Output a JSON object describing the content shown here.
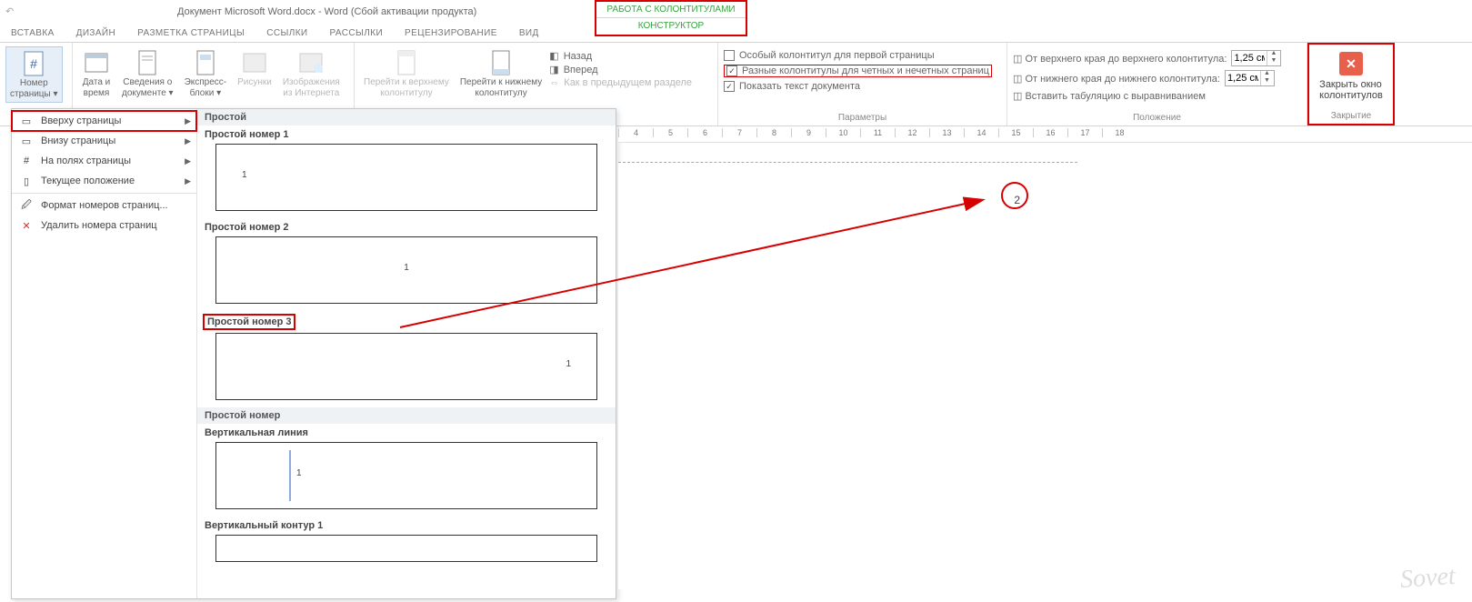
{
  "title": "Документ Microsoft Word.docx - Word (Сбой активации продукта)",
  "contextual_tab": {
    "title": "РАБОТА С КОЛОНТИТУЛАМИ",
    "tab": "КОНСТРУКТОР"
  },
  "tabs": [
    "ВСТАВКА",
    "ДИЗАЙН",
    "РАЗМЕТКА СТРАНИЦЫ",
    "ССЫЛКИ",
    "РАССЫЛКИ",
    "РЕЦЕНЗИРОВАНИЕ",
    "ВИД"
  ],
  "ribbon": {
    "page_number": {
      "line1": "Номер",
      "line2": "страницы ▾"
    },
    "datetime": {
      "line1": "Дата и",
      "line2": "время"
    },
    "docinfo": {
      "line1": "Сведения о",
      "line2": "документе ▾"
    },
    "quickparts": {
      "line1": "Экспресс-",
      "line2": "блоки ▾"
    },
    "pictures": "Рисунки",
    "online_pictures": {
      "line1": "Изображения",
      "line2": "из Интернета"
    },
    "goto_header": {
      "line1": "Перейти к верхнему",
      "line2": "колонтитулу"
    },
    "goto_footer": {
      "line1": "Перейти к нижнему",
      "line2": "колонтитулу"
    },
    "nav": {
      "prev": "Назад",
      "next": "Вперед",
      "link": "Как в предыдущем разделе"
    },
    "options": {
      "first_page": "Особый колонтитул для первой страницы",
      "odd_even": "Разные колонтитулы для четных и нечетных страниц",
      "show_doc": "Показать текст документа",
      "group": "Параметры"
    },
    "position": {
      "from_top": "◫ От верхнего края до верхнего колонтитула:",
      "from_bottom": "◫ От нижнего края до нижнего колонтитула:",
      "tab_stop": "◫ Вставить табуляцию с выравниванием",
      "val_top": "1,25 см",
      "val_bottom": "1,25 см",
      "group": "Положение"
    },
    "close": {
      "line1": "Закрыть окно",
      "line2": "колонтитулов",
      "group": "Закрытие"
    }
  },
  "dropdown": {
    "items": [
      "Вверху страницы",
      "Внизу страницы",
      "На полях страницы",
      "Текущее положение",
      "Формат номеров страниц...",
      "Удалить номера страниц"
    ],
    "gallery": {
      "section": "Простой",
      "item1": "Простой номер 1",
      "item2": "Простой номер 2",
      "item3": "Простой номер 3",
      "section2": "Простой номер",
      "item4": "Вертикальная линия",
      "item5": "Вертикальный контур 1"
    }
  },
  "ruler_marks": [
    "4",
    "5",
    "6",
    "7",
    "8",
    "9",
    "10",
    "11",
    "12",
    "13",
    "14",
    "15",
    "16",
    "17",
    "18"
  ],
  "page_number_value": "2",
  "watermark": "Sovet"
}
